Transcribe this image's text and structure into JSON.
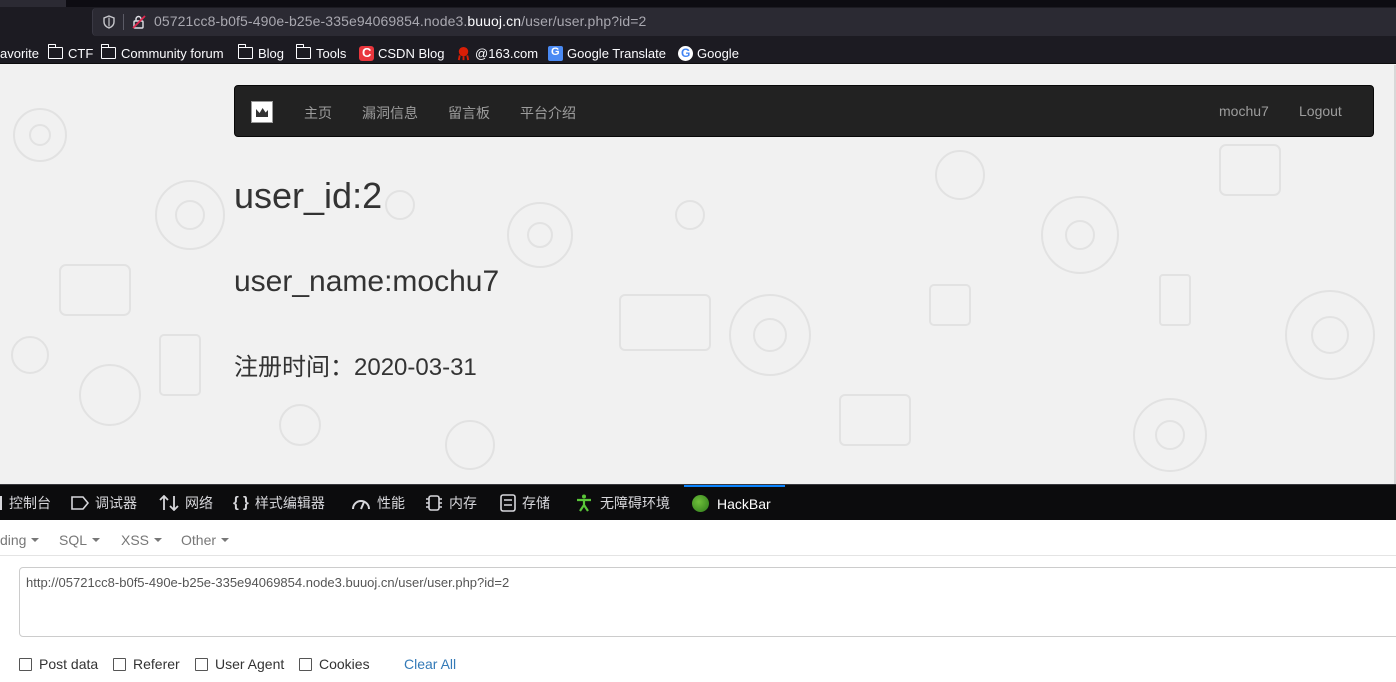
{
  "browser": {
    "url_prefix": "05721cc8-b0f5-490e-b25e-335e94069854.node3.",
    "url_domain": "buuoj.cn",
    "url_path": "/user/user.php?id=2"
  },
  "bookmarks": [
    {
      "label": "avorite",
      "icon": "folder-icon"
    },
    {
      "label": "CTF",
      "icon": "folder-icon"
    },
    {
      "label": "Community forum",
      "icon": "folder-icon"
    },
    {
      "label": "Blog",
      "icon": "folder-icon"
    },
    {
      "label": "Tools",
      "icon": "folder-icon"
    },
    {
      "label": "CSDN Blog",
      "icon": "csdn-icon"
    },
    {
      "label": "@163.com",
      "icon": "netease-icon"
    },
    {
      "label": "Google Translate",
      "icon": "google-translate-icon"
    },
    {
      "label": "Google",
      "icon": "google-icon"
    }
  ],
  "navbar": {
    "links": [
      "主页",
      "漏洞信息",
      "留言板",
      "平台介绍"
    ],
    "user": "mochu7",
    "logout": "Logout"
  },
  "profile": {
    "user_id": "user_id:2",
    "user_name": "user_name:mochu7",
    "reg_time": "注册时间：2020-03-31"
  },
  "devtools": {
    "tabs": [
      {
        "label": "控制台",
        "icon": "console-icon"
      },
      {
        "label": "调试器",
        "icon": "debugger-icon"
      },
      {
        "label": "网络",
        "icon": "network-icon"
      },
      {
        "label": "样式编辑器",
        "icon": "style-editor-icon"
      },
      {
        "label": "性能",
        "icon": "performance-icon"
      },
      {
        "label": "内存",
        "icon": "memory-icon"
      },
      {
        "label": "存储",
        "icon": "storage-icon"
      },
      {
        "label": "无障碍环境",
        "icon": "accessibility-icon"
      },
      {
        "label": "HackBar",
        "icon": "hackbar-icon",
        "active": true
      }
    ]
  },
  "hackbar": {
    "menus": [
      "ding",
      "SQL",
      "XSS",
      "Other"
    ],
    "url_value": "http://05721cc8-b0f5-490e-b25e-335e94069854.node3.buuoj.cn/user/user.php?id=2",
    "options": [
      "Post data",
      "Referer",
      "User Agent",
      "Cookies"
    ],
    "clear_all": "Clear All"
  },
  "colors": {
    "devtools_active": "#0a84ff",
    "navbar_bg": "#222222",
    "link_blue": "#337ab7"
  }
}
